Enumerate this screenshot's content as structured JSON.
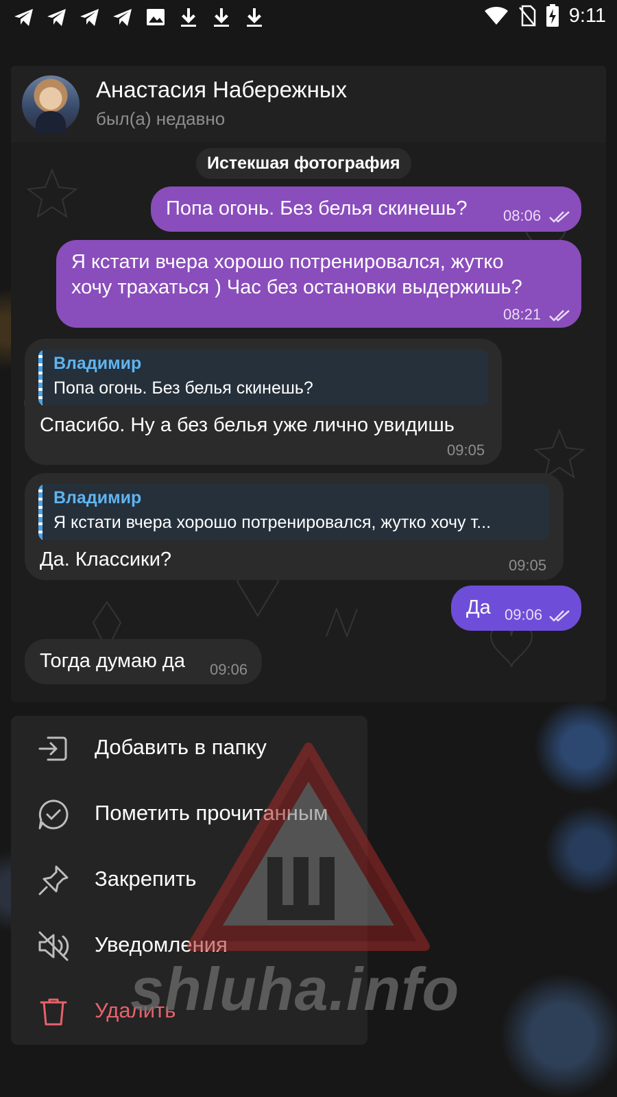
{
  "status_bar": {
    "time": "9:11",
    "left_icons": [
      "telegram-icon",
      "telegram-icon",
      "telegram-icon",
      "telegram-icon",
      "image-icon",
      "download-icon",
      "download-icon",
      "download-icon"
    ],
    "right_icons": [
      "wifi-icon",
      "no-sim-icon",
      "battery-charging-icon"
    ]
  },
  "chat": {
    "name": "Анастасия Набережных",
    "status": "был(а) недавно",
    "service_message": "Истекшая фотография",
    "messages": [
      {
        "dir": "out",
        "text": "Попа огонь. Без белья скинешь?",
        "time": "08:06"
      },
      {
        "dir": "out",
        "text_lines": [
          "Я кстати вчера хорошо потренировался, жутко",
          "хочу трахаться ) Час без остановки выдержишь?"
        ],
        "time": "08:21"
      },
      {
        "dir": "in",
        "reply": {
          "name": "Владимир",
          "text": "Попа огонь. Без белья скинешь?"
        },
        "text": "Спасибо. Ну а без белья уже лично увидишь",
        "time": "09:05"
      },
      {
        "dir": "in",
        "reply": {
          "name": "Владимир",
          "text": "Я кстати вчера хорошо потренировался, жутко хочу т..."
        },
        "text": "Да. Классики?",
        "time": "09:05"
      },
      {
        "dir": "out",
        "text": "Да",
        "time": "09:06"
      },
      {
        "dir": "in",
        "text": "Тогда думаю да",
        "time": "09:06"
      }
    ]
  },
  "menu": {
    "items": [
      {
        "label": "Добавить в папку",
        "icon": "folder-add-icon"
      },
      {
        "label": "Пометить прочитанным",
        "icon": "mark-read-icon"
      },
      {
        "label": "Закрепить",
        "icon": "pin-icon"
      },
      {
        "label": "Уведомления",
        "icon": "mute-icon"
      },
      {
        "label": "Удалить",
        "icon": "trash-icon",
        "color": "#e7626a"
      }
    ]
  },
  "watermark": {
    "text": "shluha.info",
    "letter": "Ш"
  },
  "colors": {
    "outgoing": "#8a4dbc",
    "outgoing_last": "#6e4ed8",
    "incoming": "#2b2b2b",
    "reply_name": "#5fb4f0",
    "danger": "#e7626a"
  }
}
